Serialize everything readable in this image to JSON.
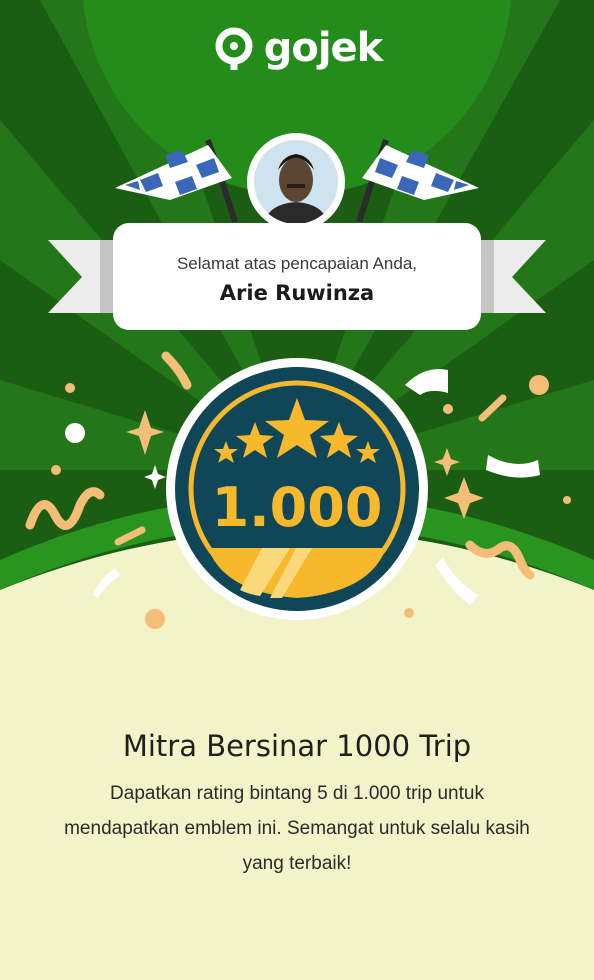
{
  "brand": {
    "name": "gojek"
  },
  "greeting": {
    "text": "Selamat atas pencapaian Anda,",
    "name": "Arie Ruwinza"
  },
  "badge": {
    "count": "1.000",
    "stars": 5
  },
  "achievement": {
    "title": "Mitra Bersinar 1000 Trip",
    "description": "Dapatkan rating bintang 5 di 1.000 trip untuk mendapatkan emblem ini. Semangat untuk selalu kasih yang terbaik!"
  },
  "colors": {
    "green_dark": "#1b5e13",
    "green": "#238c1a",
    "cream": "#f2f3c8",
    "badge_navy": "#0f4759",
    "badge_gold": "#f7b82c",
    "confetti": "#f4be78"
  }
}
